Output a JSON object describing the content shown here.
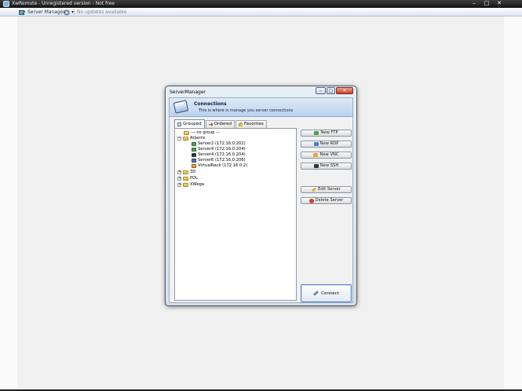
{
  "window": {
    "title": "XwRemote - Unregistered version - Not free",
    "minimize": "‒",
    "maximize": "□",
    "close": "✕"
  },
  "toolbar": {
    "server_manager": "Server Manager",
    "settings_arrow": "▾",
    "status": "No updates available"
  },
  "dialog": {
    "title": "ServerManager",
    "minimize": "–",
    "maximize": "□",
    "close": "✕",
    "header": {
      "title": "Connections",
      "subtitle": "This is where is manage you server connections"
    },
    "tabs": [
      {
        "label": "Grouped",
        "icon": "grouped-icon",
        "active": true
      },
      {
        "label": "Ordered",
        "icon": "arrow-icon",
        "active": false
      },
      {
        "label": "Favorites",
        "icon": "star-icon",
        "active": false
      }
    ],
    "tree": {
      "no_group": "--- no group ---",
      "atlantis": "Atlantis",
      "servers": [
        "Server2 (172.16.0.202)",
        "Server4 (172.16.0.204)",
        "Server4 (172.16.0.204)",
        "Server6 (172.16.0.206)",
        "VirtualRack (172.16.0.2)"
      ],
      "groups": [
        "3D",
        "PDL",
        "XWega"
      ],
      "collapse_sign": "−",
      "expand_sign": "+"
    },
    "buttons": {
      "new_ftp": "New FTP",
      "new_rdp": "New RDP",
      "new_vnc": "New VNC",
      "new_ssh": "New SSH",
      "edit_server": "Edit Server",
      "delete_server": "Delete Server",
      "connect": "Connect"
    }
  },
  "colors": {
    "accent": "#4f86c6",
    "header_band": "#b9d2ee",
    "workspace": "#f0f0f0"
  }
}
